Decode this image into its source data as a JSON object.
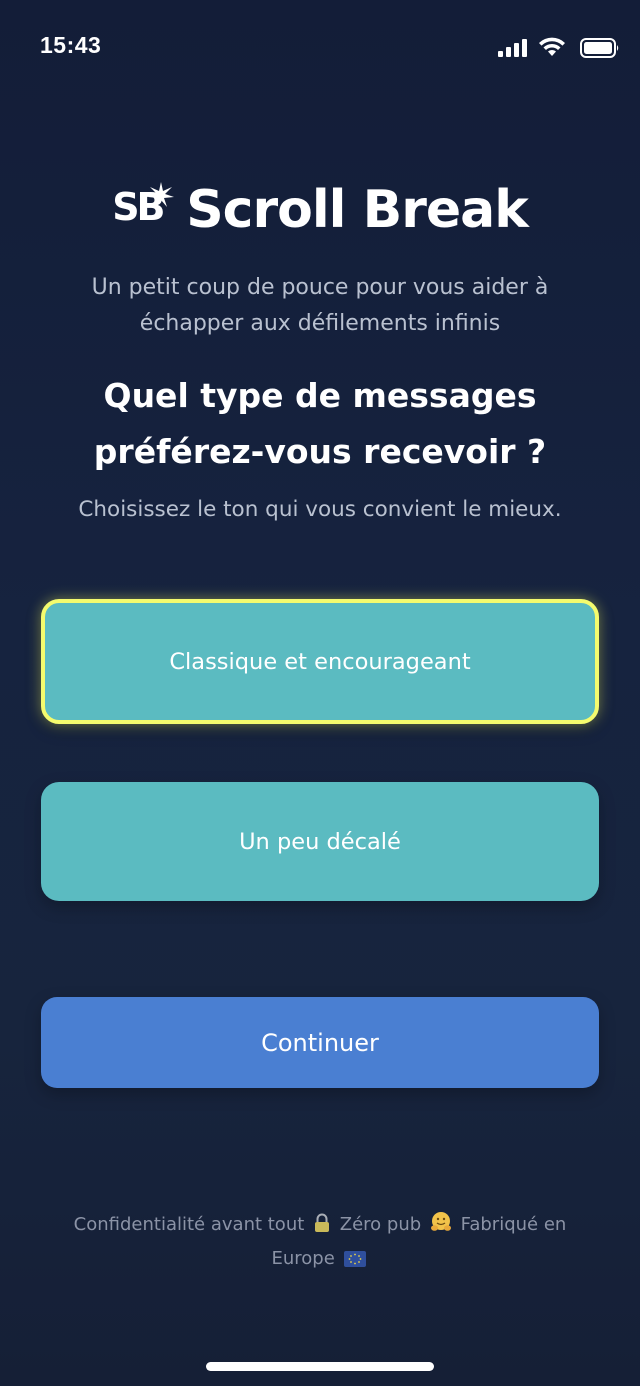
{
  "status_bar": {
    "time": "15:43",
    "icons": [
      "signal-icon",
      "wifi-icon",
      "battery-icon"
    ]
  },
  "header": {
    "logo_letters": "SB",
    "title": "Scroll Break"
  },
  "tagline": "Un petit coup de pouce pour vous aider à échapper aux défilements infinis",
  "question": "Quel type de messages préférez-vous recevoir ?",
  "subtitle": "Choisissez le ton qui vous convient le mieux.",
  "options": [
    {
      "label": "Classique et encourageant",
      "selected": true
    },
    {
      "label": "Un peu décalé",
      "selected": false
    }
  ],
  "continue_label": "Continuer",
  "footer": {
    "part1": "Confidentialité avant tout",
    "part2": "Zéro pub",
    "part3": "Fabriqué en Europe",
    "icons": [
      "lock-icon",
      "hugging-face-icon",
      "eu-flag-icon"
    ]
  },
  "colors": {
    "background": "#16223a",
    "option_fill": "#5bbbc1",
    "selected_border": "#f4fb6e",
    "continue_fill": "#4a7fd2",
    "muted_text": "#b9c1d0"
  }
}
